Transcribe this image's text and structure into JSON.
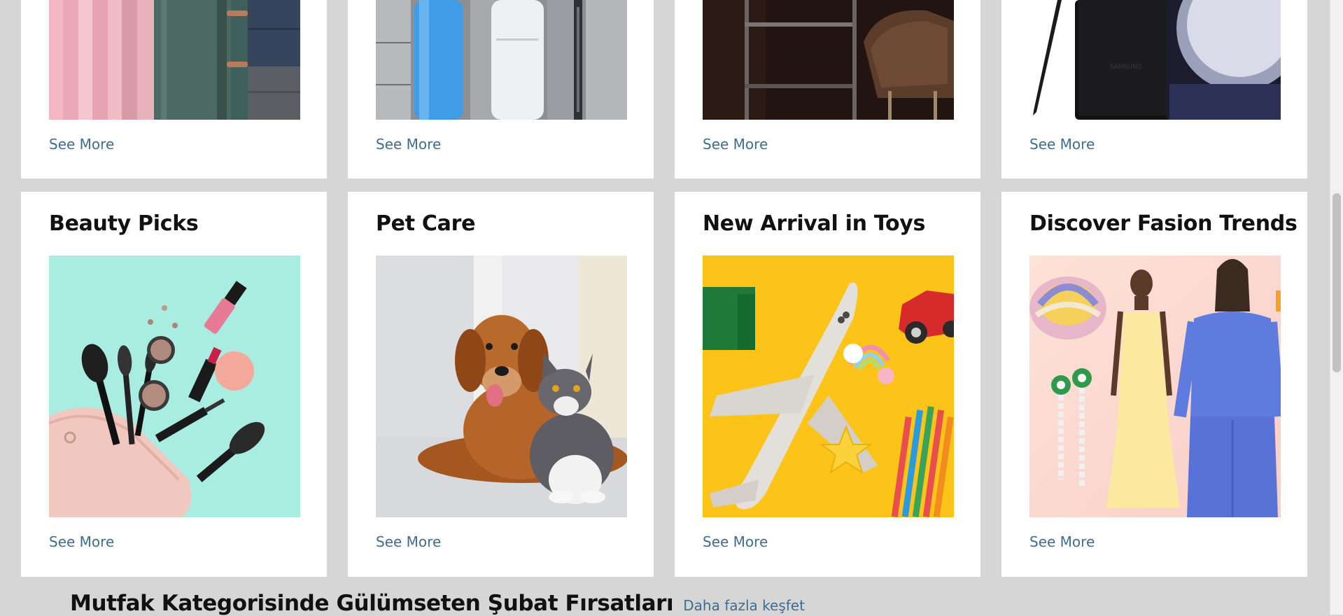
{
  "colors": {
    "background": "#d6d6d6",
    "card": "#ffffff",
    "link": "#3d6d91",
    "title": "#111111"
  },
  "top_row": [
    {
      "image_icon": "textile-towels-image",
      "see_more": "See More"
    },
    {
      "image_icon": "home-appliance-image",
      "see_more": "See More"
    },
    {
      "image_icon": "furniture-chair-image",
      "see_more": "See More"
    },
    {
      "image_icon": "smartphone-image",
      "see_more": "See More"
    }
  ],
  "bottom_row": [
    {
      "title": "Beauty Picks",
      "image_icon": "makeup-brushes-image",
      "see_more": "See More"
    },
    {
      "title": "Pet Care",
      "image_icon": "dog-and-cat-image",
      "see_more": "See More"
    },
    {
      "title": "New Arrival in Toys",
      "image_icon": "toy-airplane-image",
      "see_more": "See More"
    },
    {
      "title": "Discover Fasion Trends",
      "image_icon": "fashion-models-image",
      "see_more": "See More"
    }
  ],
  "promo": {
    "title": "Mutfak Kategorisinde Gülümseten Şubat Fırsatları",
    "link": "Daha fazla keşfet"
  }
}
